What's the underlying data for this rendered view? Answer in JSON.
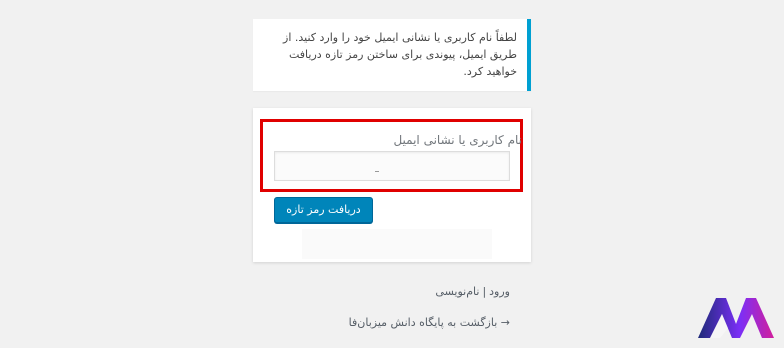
{
  "message": {
    "text": "لطفاً نام کاربری یا نشانی ایمیل خود را وارد کنید. از طریق ایمیل، پیوندی برای ساختن رمز تازه دریافت خواهید کرد."
  },
  "form": {
    "field_label": "نام کاربری یا نشانی ایمیل",
    "field_value": "",
    "submit_label": "دریافت رمز تازه"
  },
  "nav": {
    "login_label": "ورود",
    "separator": "|",
    "register_label": "نام‌نویسی",
    "back_label": "→ بازگشت به پایگاه دانش میزبان‌فا"
  },
  "colors": {
    "accent": "#00a0d2",
    "button": "#0085ba",
    "highlight": "#e00000",
    "logo_blue": "#1e2a78",
    "logo_purple": "#7b2ff7",
    "logo_magenta": "#d21f9c"
  },
  "icons": {
    "logo": "mizbanfa-logo"
  }
}
